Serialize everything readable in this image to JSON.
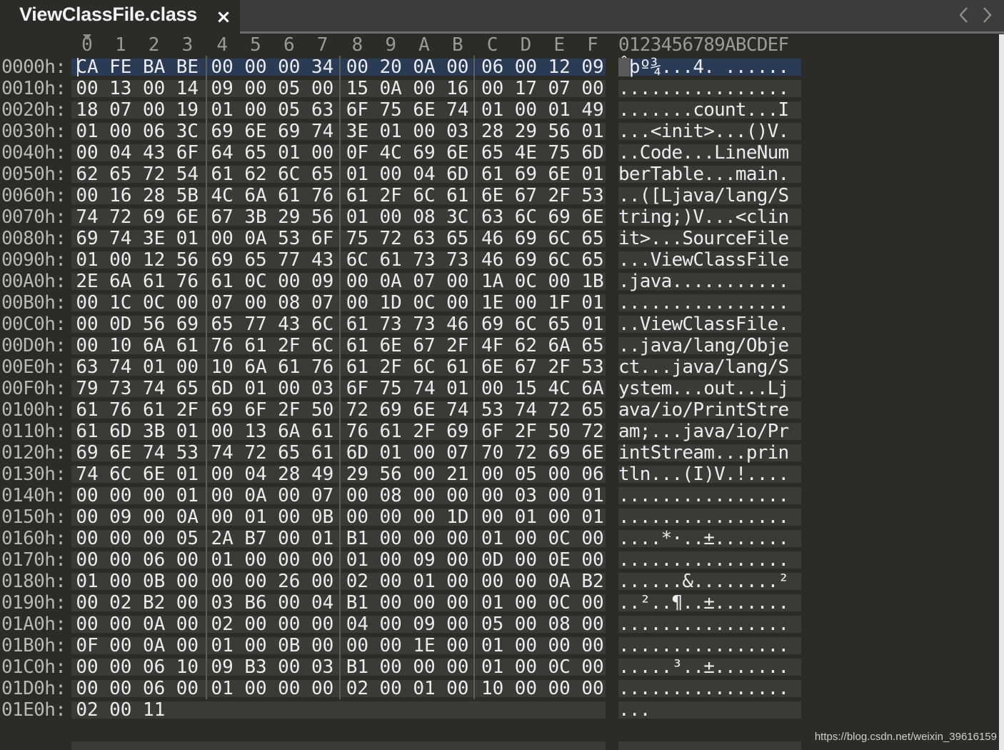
{
  "tab": {
    "title": "ViewClassFile.class",
    "close_glyph": "×"
  },
  "nav": {
    "left_icon": "chevron-left-icon",
    "right_icon": "chevron-right-icon"
  },
  "columns": [
    "0",
    "1",
    "2",
    "3",
    "4",
    "5",
    "6",
    "7",
    "8",
    "9",
    "A",
    "B",
    "C",
    "D",
    "E",
    "F"
  ],
  "ascii_header": "0123456789ABCDEF",
  "selected_row": 0,
  "rows": [
    {
      "offset": "0000h:",
      "bytes": [
        "CA",
        "FE",
        "BA",
        "BE",
        "00",
        "00",
        "00",
        "34",
        "00",
        "20",
        "0A",
        "00",
        "06",
        "00",
        "12",
        "09"
      ],
      "ascii": "Êþº¾...4. ......"
    },
    {
      "offset": "0010h:",
      "bytes": [
        "00",
        "13",
        "00",
        "14",
        "09",
        "00",
        "05",
        "00",
        "15",
        "0A",
        "00",
        "16",
        "00",
        "17",
        "07",
        "00"
      ],
      "ascii": "................"
    },
    {
      "offset": "0020h:",
      "bytes": [
        "18",
        "07",
        "00",
        "19",
        "01",
        "00",
        "05",
        "63",
        "6F",
        "75",
        "6E",
        "74",
        "01",
        "00",
        "01",
        "49"
      ],
      "ascii": ".......count...I"
    },
    {
      "offset": "0030h:",
      "bytes": [
        "01",
        "00",
        "06",
        "3C",
        "69",
        "6E",
        "69",
        "74",
        "3E",
        "01",
        "00",
        "03",
        "28",
        "29",
        "56",
        "01"
      ],
      "ascii": "...<init>...()V."
    },
    {
      "offset": "0040h:",
      "bytes": [
        "00",
        "04",
        "43",
        "6F",
        "64",
        "65",
        "01",
        "00",
        "0F",
        "4C",
        "69",
        "6E",
        "65",
        "4E",
        "75",
        "6D"
      ],
      "ascii": "..Code...LineNum"
    },
    {
      "offset": "0050h:",
      "bytes": [
        "62",
        "65",
        "72",
        "54",
        "61",
        "62",
        "6C",
        "65",
        "01",
        "00",
        "04",
        "6D",
        "61",
        "69",
        "6E",
        "01"
      ],
      "ascii": "berTable...main."
    },
    {
      "offset": "0060h:",
      "bytes": [
        "00",
        "16",
        "28",
        "5B",
        "4C",
        "6A",
        "61",
        "76",
        "61",
        "2F",
        "6C",
        "61",
        "6E",
        "67",
        "2F",
        "53"
      ],
      "ascii": "..([Ljava/lang/S"
    },
    {
      "offset": "0070h:",
      "bytes": [
        "74",
        "72",
        "69",
        "6E",
        "67",
        "3B",
        "29",
        "56",
        "01",
        "00",
        "08",
        "3C",
        "63",
        "6C",
        "69",
        "6E"
      ],
      "ascii": "tring;)V...<clin"
    },
    {
      "offset": "0080h:",
      "bytes": [
        "69",
        "74",
        "3E",
        "01",
        "00",
        "0A",
        "53",
        "6F",
        "75",
        "72",
        "63",
        "65",
        "46",
        "69",
        "6C",
        "65"
      ],
      "ascii": "it>...SourceFile"
    },
    {
      "offset": "0090h:",
      "bytes": [
        "01",
        "00",
        "12",
        "56",
        "69",
        "65",
        "77",
        "43",
        "6C",
        "61",
        "73",
        "73",
        "46",
        "69",
        "6C",
        "65"
      ],
      "ascii": "...ViewClassFile"
    },
    {
      "offset": "00A0h:",
      "bytes": [
        "2E",
        "6A",
        "61",
        "76",
        "61",
        "0C",
        "00",
        "09",
        "00",
        "0A",
        "07",
        "00",
        "1A",
        "0C",
        "00",
        "1B"
      ],
      "ascii": ".java..........."
    },
    {
      "offset": "00B0h:",
      "bytes": [
        "00",
        "1C",
        "0C",
        "00",
        "07",
        "00",
        "08",
        "07",
        "00",
        "1D",
        "0C",
        "00",
        "1E",
        "00",
        "1F",
        "01"
      ],
      "ascii": "................"
    },
    {
      "offset": "00C0h:",
      "bytes": [
        "00",
        "0D",
        "56",
        "69",
        "65",
        "77",
        "43",
        "6C",
        "61",
        "73",
        "73",
        "46",
        "69",
        "6C",
        "65",
        "01"
      ],
      "ascii": "..ViewClassFile."
    },
    {
      "offset": "00D0h:",
      "bytes": [
        "00",
        "10",
        "6A",
        "61",
        "76",
        "61",
        "2F",
        "6C",
        "61",
        "6E",
        "67",
        "2F",
        "4F",
        "62",
        "6A",
        "65"
      ],
      "ascii": "..java/lang/Obje"
    },
    {
      "offset": "00E0h:",
      "bytes": [
        "63",
        "74",
        "01",
        "00",
        "10",
        "6A",
        "61",
        "76",
        "61",
        "2F",
        "6C",
        "61",
        "6E",
        "67",
        "2F",
        "53"
      ],
      "ascii": "ct...java/lang/S"
    },
    {
      "offset": "00F0h:",
      "bytes": [
        "79",
        "73",
        "74",
        "65",
        "6D",
        "01",
        "00",
        "03",
        "6F",
        "75",
        "74",
        "01",
        "00",
        "15",
        "4C",
        "6A"
      ],
      "ascii": "ystem...out...Lj"
    },
    {
      "offset": "0100h:",
      "bytes": [
        "61",
        "76",
        "61",
        "2F",
        "69",
        "6F",
        "2F",
        "50",
        "72",
        "69",
        "6E",
        "74",
        "53",
        "74",
        "72",
        "65"
      ],
      "ascii": "ava/io/PrintStre"
    },
    {
      "offset": "0110h:",
      "bytes": [
        "61",
        "6D",
        "3B",
        "01",
        "00",
        "13",
        "6A",
        "61",
        "76",
        "61",
        "2F",
        "69",
        "6F",
        "2F",
        "50",
        "72"
      ],
      "ascii": "am;...java/io/Pr"
    },
    {
      "offset": "0120h:",
      "bytes": [
        "69",
        "6E",
        "74",
        "53",
        "74",
        "72",
        "65",
        "61",
        "6D",
        "01",
        "00",
        "07",
        "70",
        "72",
        "69",
        "6E"
      ],
      "ascii": "intStream...prin"
    },
    {
      "offset": "0130h:",
      "bytes": [
        "74",
        "6C",
        "6E",
        "01",
        "00",
        "04",
        "28",
        "49",
        "29",
        "56",
        "00",
        "21",
        "00",
        "05",
        "00",
        "06"
      ],
      "ascii": "tln...(I)V.!...."
    },
    {
      "offset": "0140h:",
      "bytes": [
        "00",
        "00",
        "00",
        "01",
        "00",
        "0A",
        "00",
        "07",
        "00",
        "08",
        "00",
        "00",
        "00",
        "03",
        "00",
        "01"
      ],
      "ascii": "................"
    },
    {
      "offset": "0150h:",
      "bytes": [
        "00",
        "09",
        "00",
        "0A",
        "00",
        "01",
        "00",
        "0B",
        "00",
        "00",
        "00",
        "1D",
        "00",
        "01",
        "00",
        "01"
      ],
      "ascii": "................"
    },
    {
      "offset": "0160h:",
      "bytes": [
        "00",
        "00",
        "00",
        "05",
        "2A",
        "B7",
        "00",
        "01",
        "B1",
        "00",
        "00",
        "00",
        "01",
        "00",
        "0C",
        "00"
      ],
      "ascii": "....*·..±......."
    },
    {
      "offset": "0170h:",
      "bytes": [
        "00",
        "00",
        "06",
        "00",
        "01",
        "00",
        "00",
        "00",
        "01",
        "00",
        "09",
        "00",
        "0D",
        "00",
        "0E",
        "00"
      ],
      "ascii": "................"
    },
    {
      "offset": "0180h:",
      "bytes": [
        "01",
        "00",
        "0B",
        "00",
        "00",
        "00",
        "26",
        "00",
        "02",
        "00",
        "01",
        "00",
        "00",
        "00",
        "0A",
        "B2"
      ],
      "ascii": "......&........²"
    },
    {
      "offset": "0190h:",
      "bytes": [
        "00",
        "02",
        "B2",
        "00",
        "03",
        "B6",
        "00",
        "04",
        "B1",
        "00",
        "00",
        "00",
        "01",
        "00",
        "0C",
        "00"
      ],
      "ascii": "..²..¶..±......."
    },
    {
      "offset": "01A0h:",
      "bytes": [
        "00",
        "00",
        "0A",
        "00",
        "02",
        "00",
        "00",
        "00",
        "04",
        "00",
        "09",
        "00",
        "05",
        "00",
        "08",
        "00"
      ],
      "ascii": "................"
    },
    {
      "offset": "01B0h:",
      "bytes": [
        "0F",
        "00",
        "0A",
        "00",
        "01",
        "00",
        "0B",
        "00",
        "00",
        "00",
        "1E",
        "00",
        "01",
        "00",
        "00",
        "00"
      ],
      "ascii": "................"
    },
    {
      "offset": "01C0h:",
      "bytes": [
        "00",
        "00",
        "06",
        "10",
        "09",
        "B3",
        "00",
        "03",
        "B1",
        "00",
        "00",
        "00",
        "01",
        "00",
        "0C",
        "00"
      ],
      "ascii": ".....³..±......."
    },
    {
      "offset": "01D0h:",
      "bytes": [
        "00",
        "00",
        "06",
        "00",
        "01",
        "00",
        "00",
        "00",
        "02",
        "00",
        "01",
        "00",
        "10",
        "00",
        "00",
        "00"
      ],
      "ascii": "................"
    },
    {
      "offset": "01E0h:",
      "bytes": [
        "02",
        "00",
        "11"
      ],
      "ascii": "..."
    }
  ],
  "watermark": "https://blog.csdn.net/weixin_39616159",
  "colors": {
    "background": "#2b2b28",
    "row_band": "#3a3a37",
    "selection": "#2a3b56",
    "text": "#ececec"
  }
}
